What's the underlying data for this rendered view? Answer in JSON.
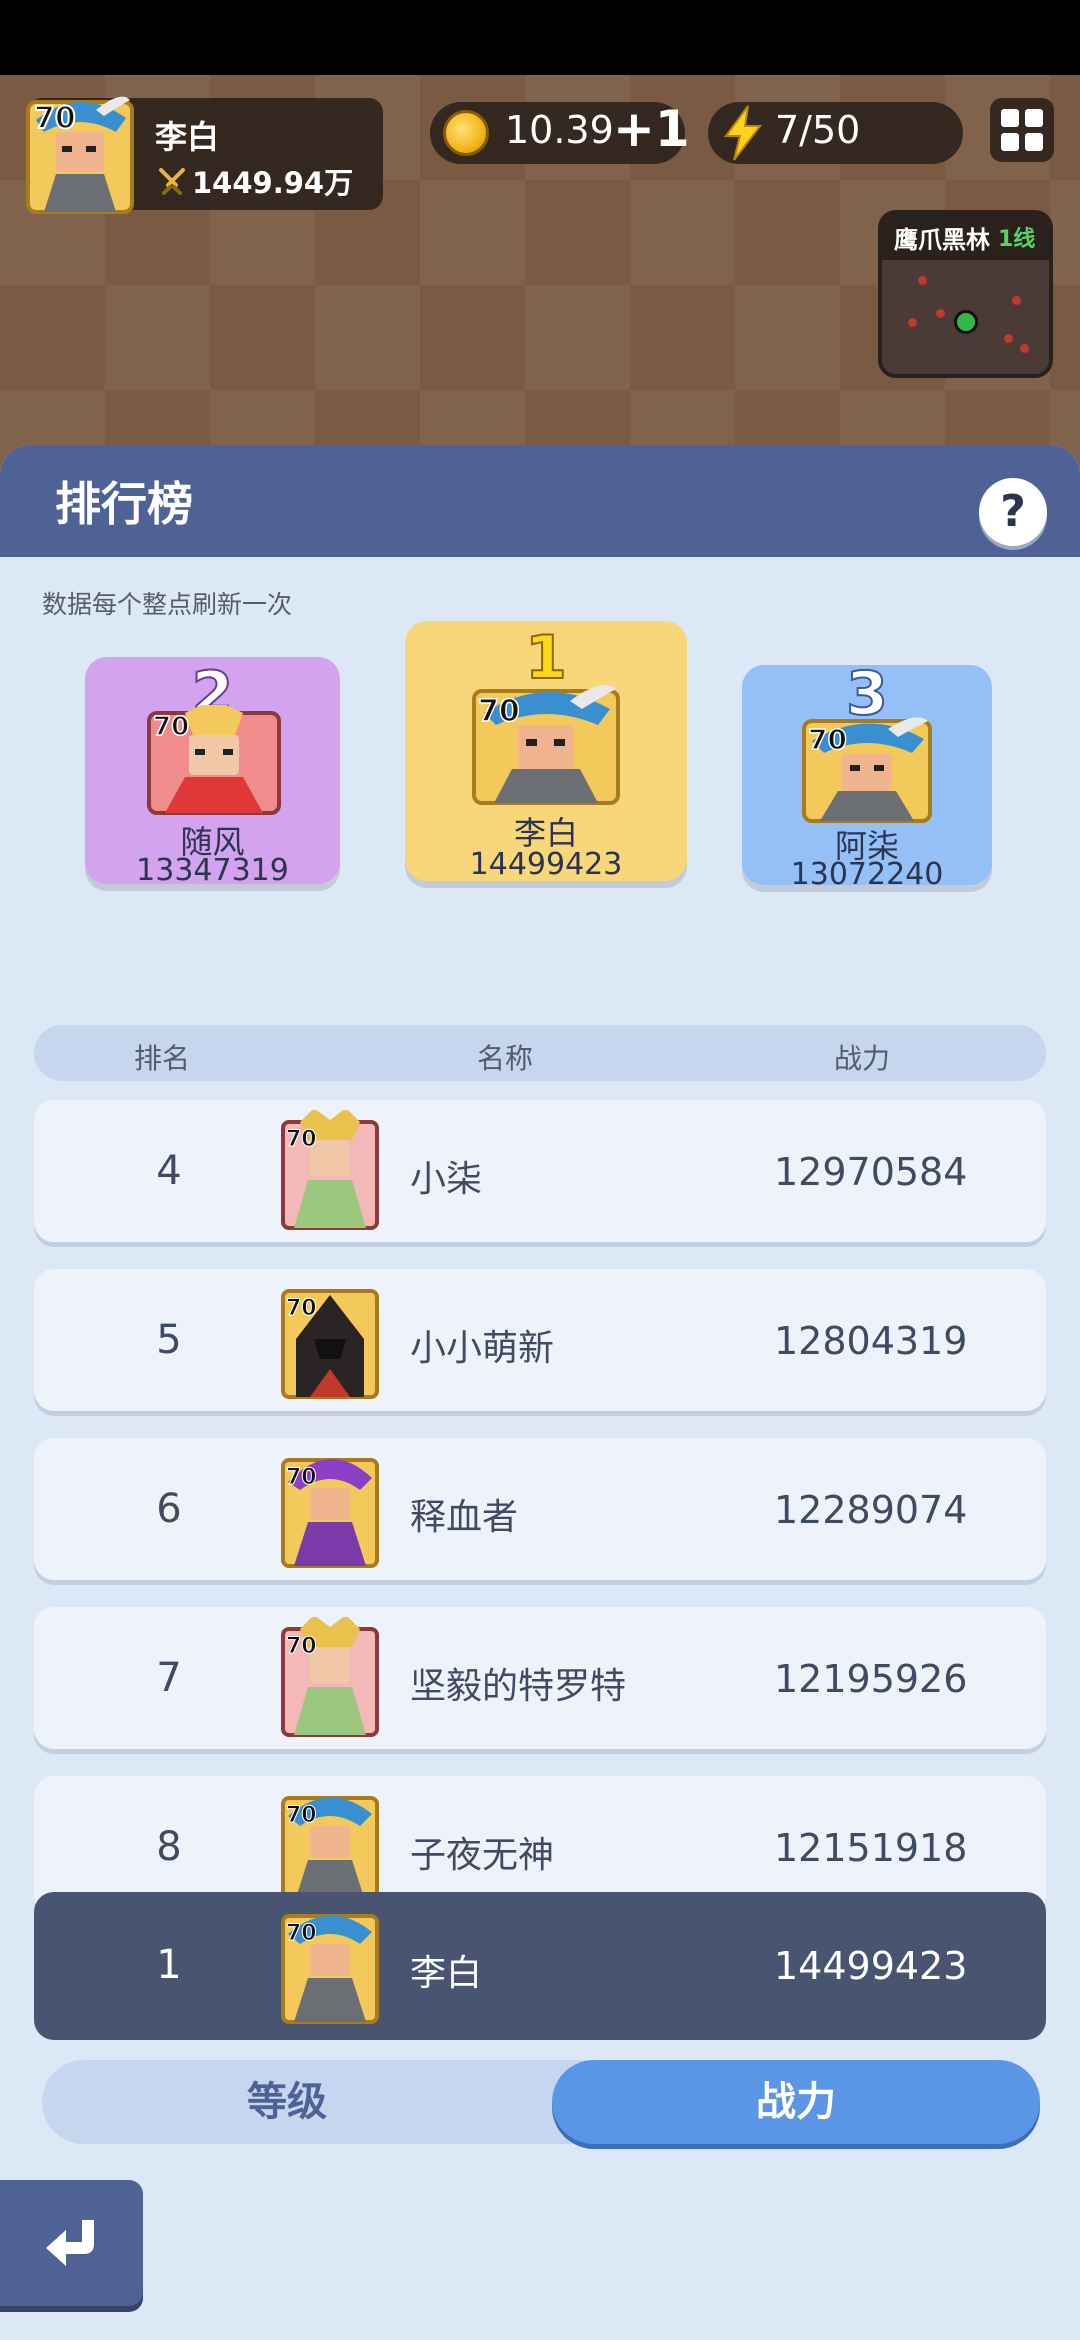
{
  "hud": {
    "player_level": "70",
    "player_name": "李白",
    "player_power": "1449.94万",
    "coins": "10.39",
    "coins_plus": "+1",
    "energy": "7/50",
    "minimap_area": "鹰爪黑林",
    "minimap_line": "1线"
  },
  "leaderboard": {
    "title": "排行榜",
    "help_label": "?",
    "refresh_note": "数据每个整点刷新一次",
    "podium": [
      {
        "rank": "1",
        "name": "李白",
        "score": "14499423",
        "level": "70",
        "color": "#f8d67a"
      },
      {
        "rank": "2",
        "name": "随风",
        "score": "13347319",
        "level": "70",
        "color": "#d4a3f0"
      },
      {
        "rank": "3",
        "name": "阿柒",
        "score": "13072240",
        "level": "70",
        "color": "#94bff7"
      }
    ],
    "columns": {
      "rank": "排名",
      "name": "名称",
      "power": "战力"
    },
    "rows": [
      {
        "rank": "4",
        "name": "小柒",
        "power": "12970584",
        "level": "70"
      },
      {
        "rank": "5",
        "name": "小小萌新",
        "power": "12804319",
        "level": "70"
      },
      {
        "rank": "6",
        "name": "释血者",
        "power": "12289074",
        "level": "70"
      },
      {
        "rank": "7",
        "name": "坚毅的特罗特",
        "power": "12195926",
        "level": "70"
      },
      {
        "rank": "8",
        "name": "子夜无神",
        "power": "12151918",
        "level": "70"
      }
    ],
    "self_row": {
      "rank": "1",
      "name": "李白",
      "power": "14499423",
      "level": "70"
    },
    "tabs": {
      "level": "等级",
      "power": "战力",
      "active": "power"
    }
  },
  "colors": {
    "panel_header": "#4f6296",
    "panel_bg": "#dde8f6",
    "self_row": "#485470",
    "tab_active": "#5b96e6"
  }
}
